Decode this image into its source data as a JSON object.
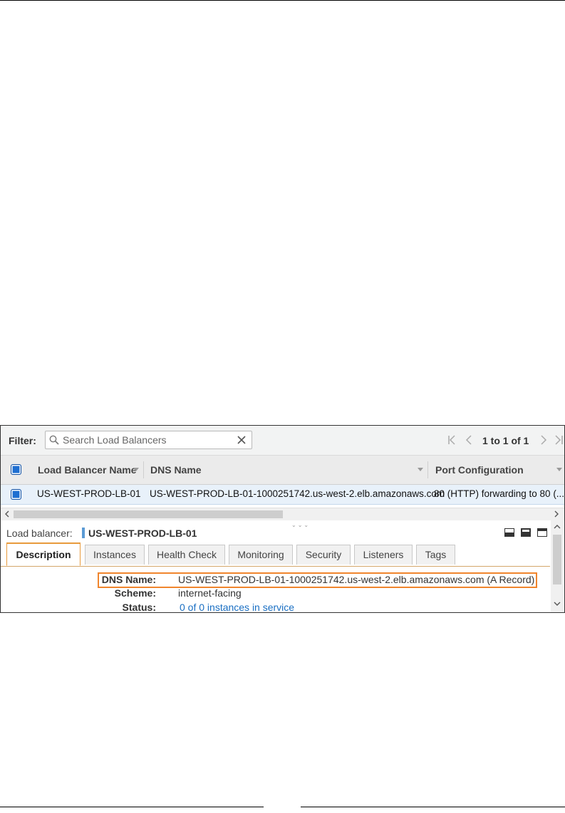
{
  "filter": {
    "label": "Filter:",
    "search_placeholder": "Search Load Balancers",
    "search_value": "",
    "pager_text": "1 to 1 of 1"
  },
  "table": {
    "columns": [
      "Load Balancer Name",
      "DNS Name",
      "Port Configuration"
    ],
    "rows": [
      {
        "name": "US-WEST-PROD-LB-01",
        "dns": "US-WEST-PROD-LB-01-1000251742.us-west-2.elb.amazonaws.com",
        "port": "80 (HTTP) forwarding to 80 (..."
      }
    ]
  },
  "detail": {
    "title_label": "Load balancer:",
    "title_name": "US-WEST-PROD-LB-01",
    "tabs": [
      "Description",
      "Instances",
      "Health Check",
      "Monitoring",
      "Security",
      "Listeners",
      "Tags"
    ],
    "active_tab": "Description",
    "fields": [
      {
        "label": "DNS Name:",
        "value": "US-WEST-PROD-LB-01-1000251742.us-west-2.elb.amazonaws.com (A Record)"
      },
      {
        "label": "Scheme:",
        "value": "internet-facing"
      },
      {
        "label": "Status:",
        "value": "0 of 0 instances in service"
      }
    ]
  },
  "colors": {
    "checkbox_blue": "#1f6fd1",
    "highlight_orange": "#f0852d",
    "link_blue": "#1a6fc3",
    "selected_row": "#e8f1fa"
  }
}
